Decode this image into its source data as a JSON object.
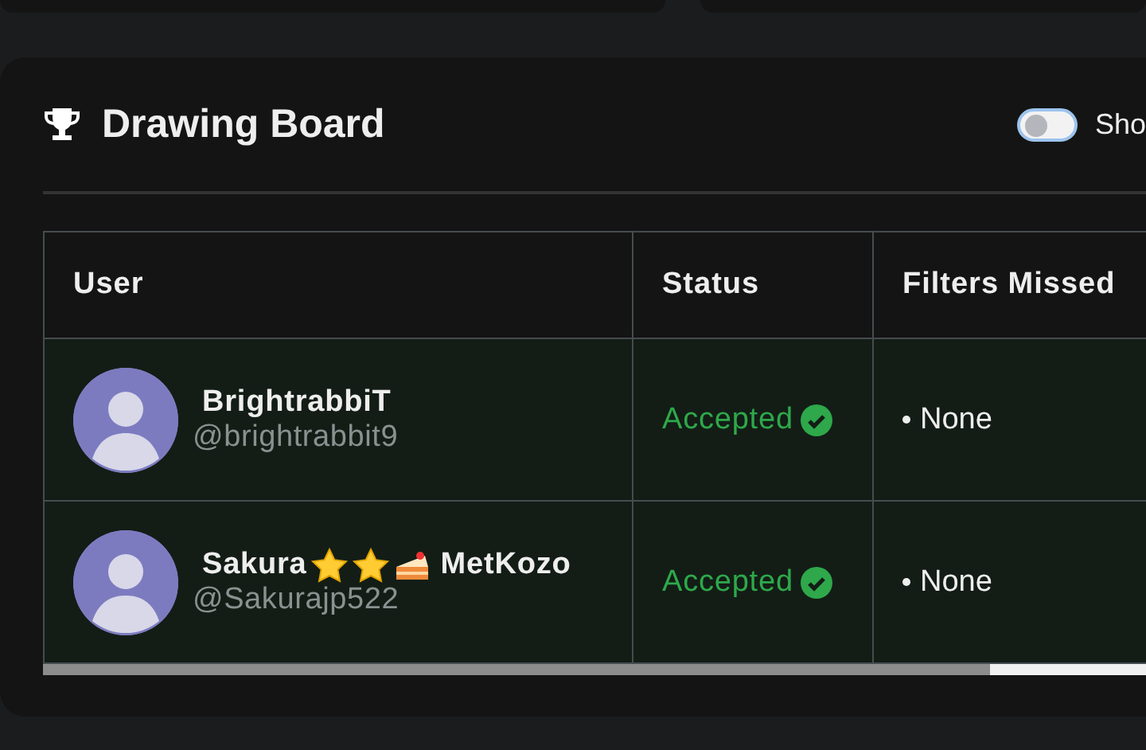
{
  "panel": {
    "title": "Drawing Board",
    "toggle": {
      "label": "Sho",
      "on": false
    }
  },
  "table": {
    "columns": [
      "User",
      "Status",
      "Filters Missed"
    ],
    "rows": [
      {
        "name": "BrightrabbiT",
        "handle": "@brightrabbit9",
        "status": {
          "text": "Accepted",
          "kind": "accepted"
        },
        "filters": [
          "None"
        ]
      },
      {
        "name": "Sakura",
        "badges": [
          {
            "kind": "star"
          },
          {
            "kind": "star"
          },
          {
            "kind": "cake"
          }
        ],
        "name_suffix": "MetKozo",
        "handle": "@Sakurajp522",
        "status": {
          "text": "Accepted",
          "kind": "accepted"
        },
        "filters": [
          "None"
        ]
      }
    ]
  }
}
